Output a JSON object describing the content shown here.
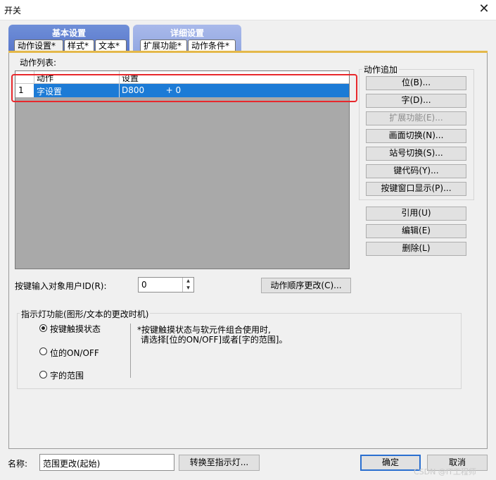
{
  "window": {
    "title": "开关",
    "close_glyph": "✕"
  },
  "tab_groups": [
    {
      "label": "基本设置",
      "tabs": [
        "动作设置*",
        "样式*",
        "文本*"
      ]
    },
    {
      "label": "详细设置",
      "tabs": [
        "扩展功能*",
        "动作条件*"
      ]
    }
  ],
  "action_list": {
    "label": "动作列表:",
    "columns": [
      "动作",
      "设置"
    ],
    "rows": [
      {
        "num": "1",
        "action": "字设置",
        "setting": "D800        + 0"
      }
    ]
  },
  "action_add": {
    "label": "动作追加",
    "buttons": [
      "位(B)...",
      "字(D)...",
      "扩展功能(E)...",
      "画面切换(N)...",
      "站号切换(S)...",
      "键代码(Y)...",
      "按键窗口显示(P)..."
    ]
  },
  "edit_buttons": [
    "引用(U)",
    "编辑(E)",
    "删除(L)"
  ],
  "user_id": {
    "label": "按键输入对象用户ID(R):",
    "value": "0"
  },
  "order_button": "动作顺序更改(C)...",
  "indicator": {
    "label": "指示灯功能(图形/文本的更改时机)",
    "options": [
      "按键触摸状态",
      "位的ON/OFF",
      "字的范围"
    ],
    "selected": "按键触摸状态",
    "note_line1": "*按键触摸状态与软元件组合使用时,",
    "note_line2": "请选择[位的ON/OFF]或者[字的范围]。"
  },
  "footer": {
    "name_label": "名称:",
    "name_value": "范围更改(起始)",
    "convert_button": "转换至指示灯...",
    "ok": "确定",
    "cancel": "取消"
  },
  "watermark": "CSDN @IT工程师"
}
